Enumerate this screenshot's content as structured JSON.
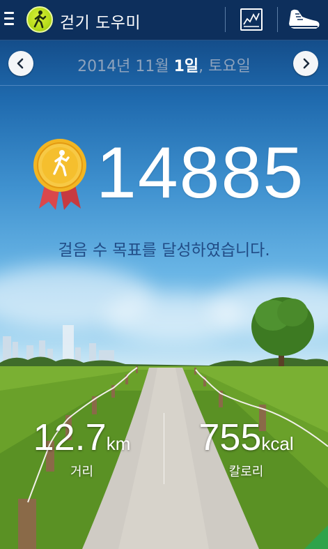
{
  "app": {
    "title": "걷기 도우미",
    "logo_icon": "walker-icon",
    "menu_icon": "menu-icon",
    "actions": [
      {
        "name": "chart-button",
        "icon": "chart-icon"
      },
      {
        "name": "shoe-button",
        "icon": "shoe-icon"
      }
    ]
  },
  "date": {
    "year_month": "2014년 11월 ",
    "day": "1일",
    "weekday": ", 토요일",
    "prev_icon": "chevron-left-icon",
    "next_icon": "chevron-right-icon"
  },
  "achievement": {
    "steps": "14885",
    "message": "걸음 수 목표를 달성하였습니다.",
    "medal_icon": "gold-medal-icon"
  },
  "stats": {
    "distance": {
      "value": "12.7",
      "unit": "km",
      "label": "거리"
    },
    "calories": {
      "value": "755",
      "unit": "kcal",
      "label": "칼로리"
    }
  },
  "colors": {
    "topbar": "#0d2f5c",
    "message": "#214c86",
    "logo": "#b6dc1a",
    "medal_gold": "#f2b623",
    "ribbon": "#d9484c"
  }
}
